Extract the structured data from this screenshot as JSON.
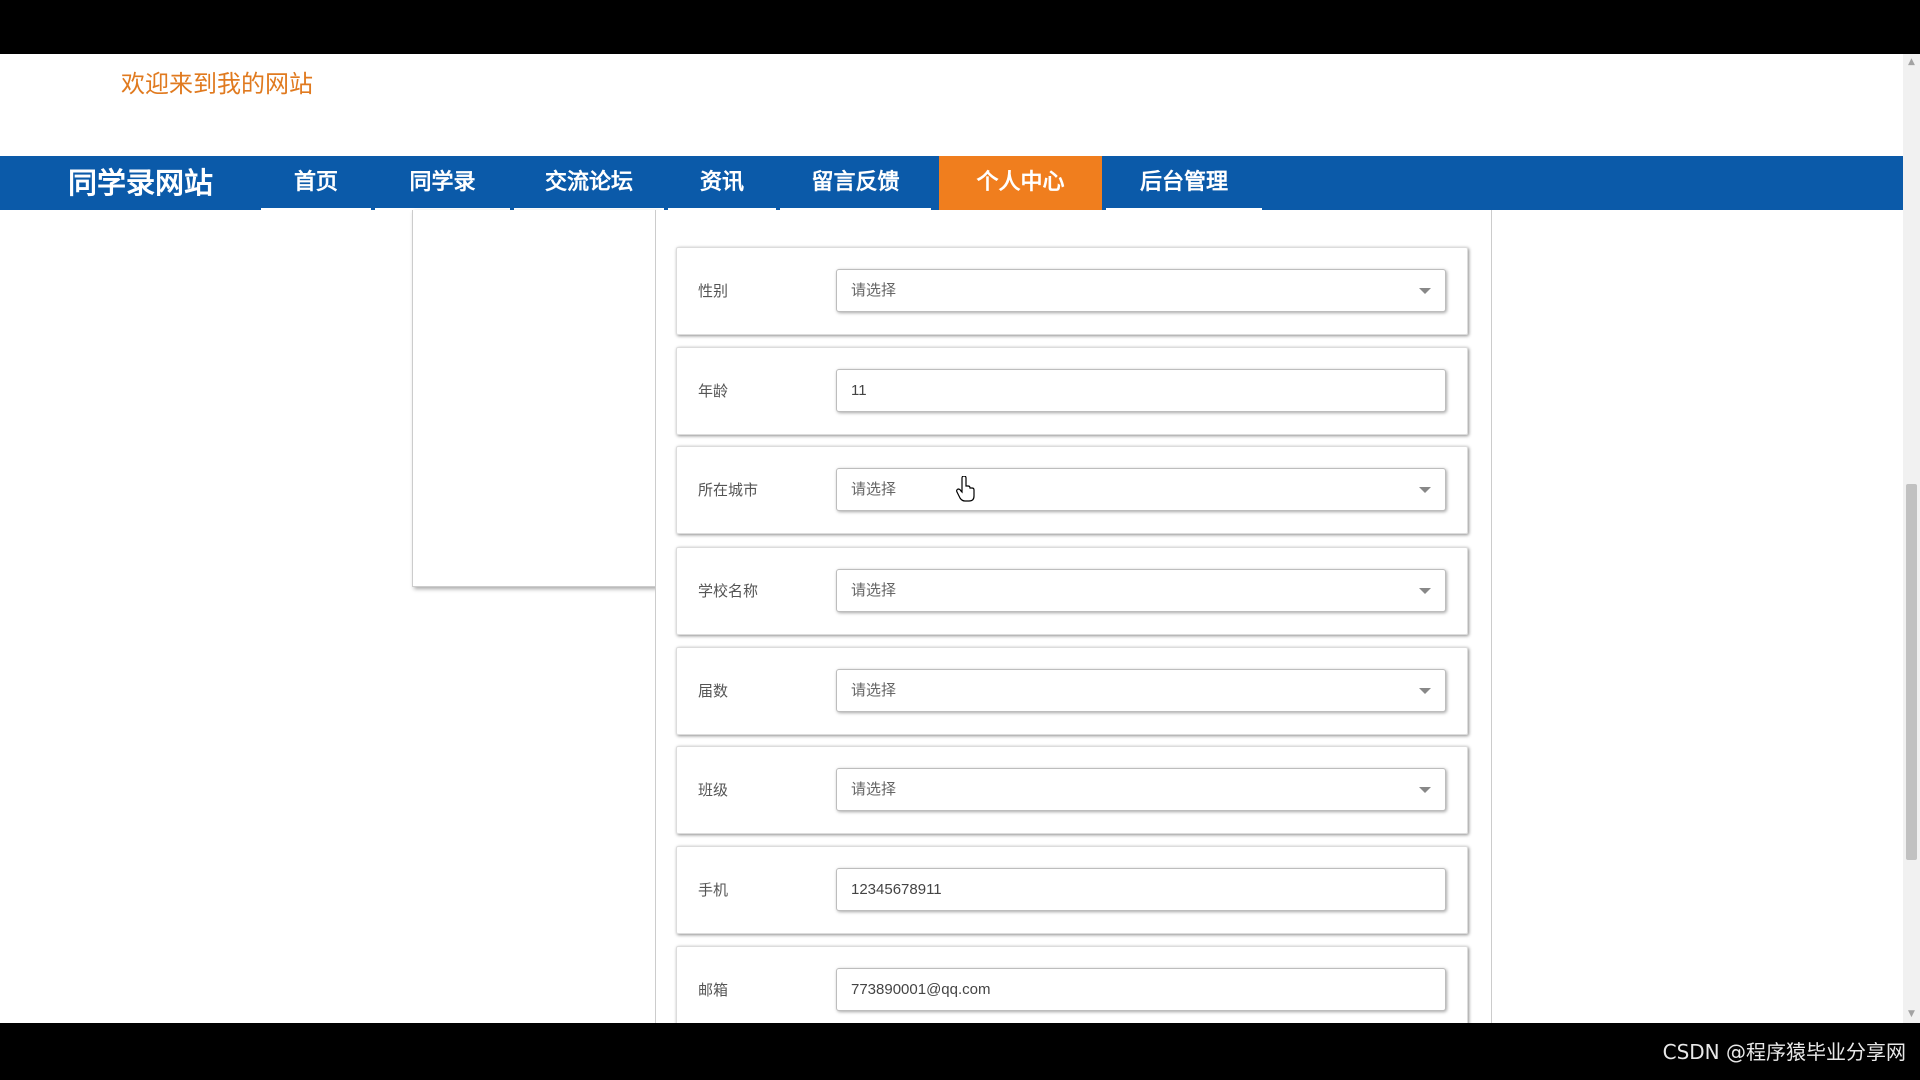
{
  "header": {
    "welcome": "欢迎来到我的网站"
  },
  "navbar": {
    "brand": "同学录网站",
    "items": [
      {
        "label": "首页",
        "active": false
      },
      {
        "label": "同学录",
        "active": false
      },
      {
        "label": "交流论坛",
        "active": false
      },
      {
        "label": "资讯",
        "active": false
      },
      {
        "label": "留言反馈",
        "active": false
      },
      {
        "label": "个人中心",
        "active": true
      },
      {
        "label": "后台管理",
        "active": false
      }
    ]
  },
  "form": {
    "fields": [
      {
        "label": "性别",
        "type": "select",
        "value": "请选择"
      },
      {
        "label": "年龄",
        "type": "input",
        "value": "11"
      },
      {
        "label": "所在城市",
        "type": "select",
        "value": "请选择"
      },
      {
        "label": "学校名称",
        "type": "select",
        "value": "请选择"
      },
      {
        "label": "届数",
        "type": "select",
        "value": "请选择"
      },
      {
        "label": "班级",
        "type": "select",
        "value": "请选择"
      },
      {
        "label": "手机",
        "type": "input",
        "value": "12345678911"
      },
      {
        "label": "邮箱",
        "type": "input",
        "value": "773890001@qq.com"
      }
    ]
  },
  "watermark": "CSDN @程序猿毕业分享网",
  "colors": {
    "nav_bg": "#0b5aa9",
    "nav_active": "#f07e1e",
    "welcome": "#e07a1f"
  },
  "icons": {
    "select_caret": "caret-down-icon",
    "cursor": "hand-pointer-icon"
  }
}
